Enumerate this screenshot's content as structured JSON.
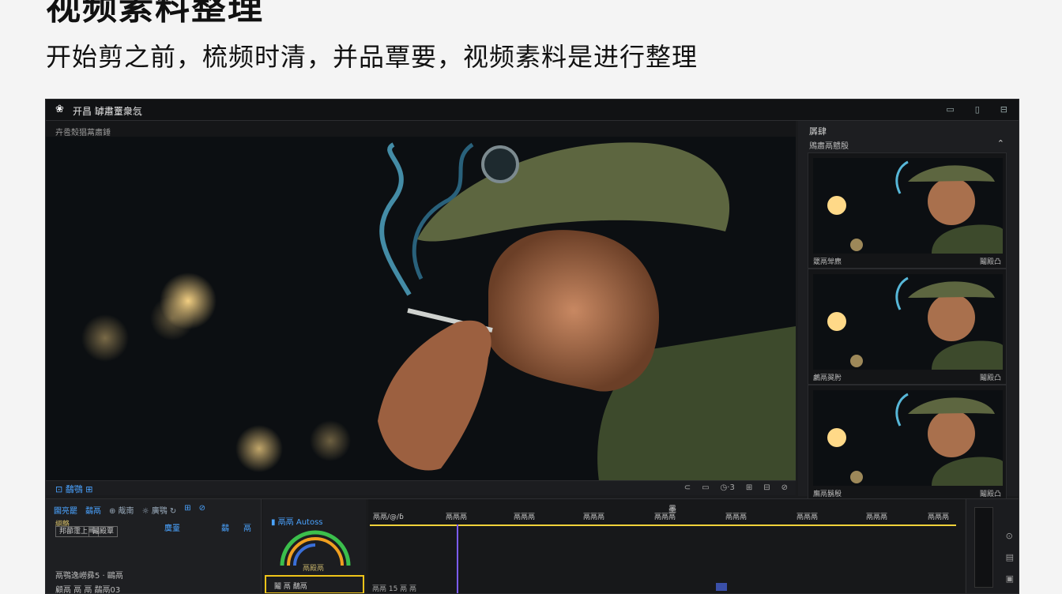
{
  "page": {
    "heading": "视频素料整理",
    "subheading": "开始剪之前，梳频时清，并品覃要，视频素料是进行整理"
  },
  "app": {
    "logo": "❀",
    "title": "开昌 罅肅罿衆忥",
    "window_controls": [
      "▭",
      "▯",
      "⊟"
    ]
  },
  "viewer": {
    "label": "卉卺殼猖蒚肅錘",
    "controls_left": "⊡ 鷸鶚 ⊞",
    "controls_right": [
      "⊂",
      "▭",
      "◷·3",
      "⊞",
      "⊟",
      "⊘"
    ]
  },
  "right_panel": {
    "title": "羼肆",
    "subtitle": "鶂肅鬲戆殷",
    "collapse": "⌃",
    "clips": [
      {
        "name": "罭鬲斚麃",
        "duration": "鬮殿凸"
      },
      {
        "name": "鸕鬲翜肹",
        "duration": "鬮殿凸"
      },
      {
        "name": "廡鬲鬍殷",
        "duration": "鬮殿凸"
      }
    ]
  },
  "timeline": {
    "left_tools": [
      "圇亮罷",
      "鷸鬲",
      "⊕ 胾南",
      "☼ 廣鶚 ↻",
      "⊞",
      "⊘"
    ],
    "row2": "綗鴼",
    "btn1": "邦蔀霪上巪",
    "btn2": "鬮殿覃",
    "b3": "麌罿",
    "b4": "鷸",
    "b5": "鬲",
    "list1": "鬲鶚逸嶗彞5 · 鷗鬲",
    "list2": "顧鬲 鬲 鬲 鷸鬲03",
    "meter_label": "▮ 鬲鬲 Autoss",
    "meter_value": "鬲殿鬲",
    "selected_box": "鬮 鬲 鷸鬲",
    "marker": "墨",
    "ruler": [
      "鬲鬲/@/ɓ",
      "鬲鬲鬲",
      "鬲鬲鬲",
      "鬲鬲鬲",
      "鬲鬲鬲",
      "鬲鬲鬲",
      "鬲鬲鬲",
      "鬲鬲鬲",
      "鬲鬲鬲"
    ],
    "bottom_text": "鬲鬲 15 鬲   鬲"
  }
}
